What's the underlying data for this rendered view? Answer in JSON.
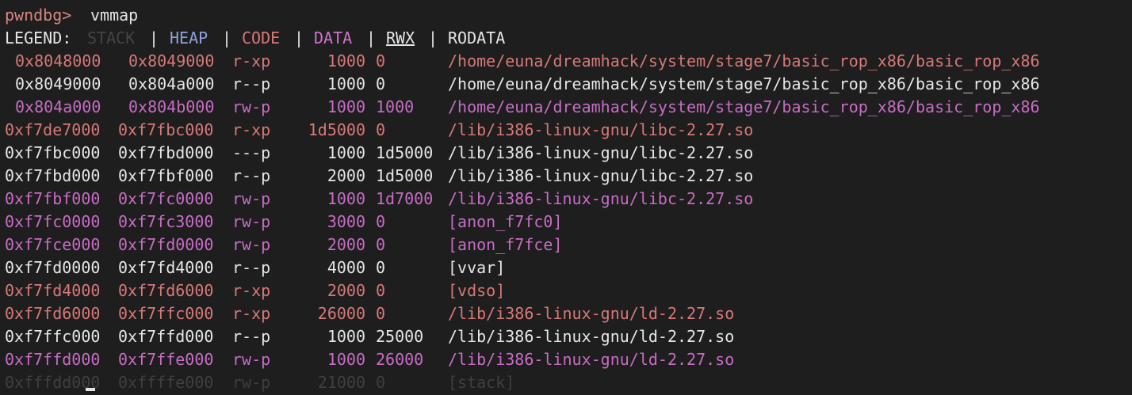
{
  "prompt": {
    "label": "pwndbg>",
    "command": "vmmap"
  },
  "legend": {
    "title": "LEGEND:",
    "separator": "|",
    "items": [
      {
        "key": "stack",
        "label": "STACK",
        "color": "#444444"
      },
      {
        "key": "heap",
        "label": "HEAP",
        "color": "#8fa0dc"
      },
      {
        "key": "code",
        "label": "CODE",
        "color": "#d87878"
      },
      {
        "key": "data",
        "label": "DATA",
        "color": "#d073cc"
      },
      {
        "key": "rwx",
        "label": "RWX",
        "color": "#e6e6e6"
      },
      {
        "key": "rodata",
        "label": "RODATA",
        "color": "#e6e6e6"
      }
    ]
  },
  "mappings": [
    {
      "start": "0x8048000",
      "end": "0x8049000",
      "perm": "r-xp",
      "size": "1000",
      "offset": "0",
      "path": "/home/euna/dreamhack/system/stage7/basic_rop_x86/basic_rop_x86",
      "kind": "code"
    },
    {
      "start": "0x8049000",
      "end": "0x804a000",
      "perm": "r--p",
      "size": "1000",
      "offset": "0",
      "path": "/home/euna/dreamhack/system/stage7/basic_rop_x86/basic_rop_x86",
      "kind": "rodata"
    },
    {
      "start": "0x804a000",
      "end": "0x804b000",
      "perm": "rw-p",
      "size": "1000",
      "offset": "1000",
      "path": "/home/euna/dreamhack/system/stage7/basic_rop_x86/basic_rop_x86",
      "kind": "data"
    },
    {
      "start": "0xf7de7000",
      "end": "0xf7fbc000",
      "perm": "r-xp",
      "size": "1d5000",
      "offset": "0",
      "path": "/lib/i386-linux-gnu/libc-2.27.so",
      "kind": "code"
    },
    {
      "start": "0xf7fbc000",
      "end": "0xf7fbd000",
      "perm": "---p",
      "size": "1000",
      "offset": "1d5000",
      "path": "/lib/i386-linux-gnu/libc-2.27.so",
      "kind": "rodata"
    },
    {
      "start": "0xf7fbd000",
      "end": "0xf7fbf000",
      "perm": "r--p",
      "size": "2000",
      "offset": "1d5000",
      "path": "/lib/i386-linux-gnu/libc-2.27.so",
      "kind": "rodata"
    },
    {
      "start": "0xf7fbf000",
      "end": "0xf7fc0000",
      "perm": "rw-p",
      "size": "1000",
      "offset": "1d7000",
      "path": "/lib/i386-linux-gnu/libc-2.27.so",
      "kind": "data"
    },
    {
      "start": "0xf7fc0000",
      "end": "0xf7fc3000",
      "perm": "rw-p",
      "size": "3000",
      "offset": "0",
      "path": "[anon_f7fc0]",
      "kind": "data"
    },
    {
      "start": "0xf7fce000",
      "end": "0xf7fd0000",
      "perm": "rw-p",
      "size": "2000",
      "offset": "0",
      "path": "[anon_f7fce]",
      "kind": "data"
    },
    {
      "start": "0xf7fd0000",
      "end": "0xf7fd4000",
      "perm": "r--p",
      "size": "4000",
      "offset": "0",
      "path": "[vvar]",
      "kind": "rodata"
    },
    {
      "start": "0xf7fd4000",
      "end": "0xf7fd6000",
      "perm": "r-xp",
      "size": "2000",
      "offset": "0",
      "path": "[vdso]",
      "kind": "code"
    },
    {
      "start": "0xf7fd6000",
      "end": "0xf7ffc000",
      "perm": "r-xp",
      "size": "26000",
      "offset": "0",
      "path": "/lib/i386-linux-gnu/ld-2.27.so",
      "kind": "code"
    },
    {
      "start": "0xf7ffc000",
      "end": "0xf7ffd000",
      "perm": "r--p",
      "size": "1000",
      "offset": "25000",
      "path": "/lib/i386-linux-gnu/ld-2.27.so",
      "kind": "rodata"
    },
    {
      "start": "0xf7ffd000",
      "end": "0xf7ffe000",
      "perm": "rw-p",
      "size": "1000",
      "offset": "26000",
      "path": "/lib/i386-linux-gnu/ld-2.27.so",
      "kind": "data"
    },
    {
      "start": "0xfffdd000",
      "end": "0xffffe000",
      "perm": "rw-p",
      "size": "21000",
      "offset": "0",
      "path": "[stack]",
      "kind": "stack"
    }
  ]
}
